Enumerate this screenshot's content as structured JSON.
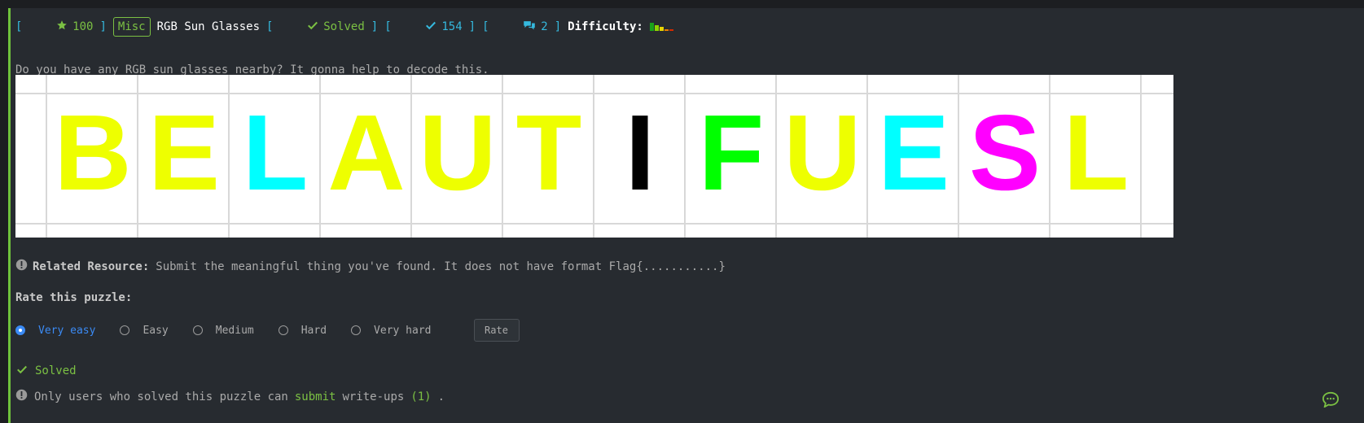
{
  "header": {
    "bracket_open": "[",
    "points": "100",
    "bracket_close": "]",
    "category": "Misc",
    "title": "RGB Sun Glasses",
    "solved_open": "[",
    "solved_label": "Solved",
    "solved_close": "]",
    "solves_open": "[",
    "solves_count": "154",
    "solves_close": "]",
    "comments_open": "[",
    "comments_count": "2",
    "comments_close": "]",
    "difficulty_label": "Difficulty:",
    "difficulty_colors": [
      "#1aa21a",
      "#8fd400",
      "#e6d300",
      "#e67e00",
      "#d42a00"
    ]
  },
  "description": "Do you have any RGB sun glasses nearby? It gonna help to decode this.",
  "puzzle_image": {
    "letters": [
      {
        "char": "B",
        "color": "#eeff00"
      },
      {
        "char": "E",
        "color": "#eeff00"
      },
      {
        "char": "L",
        "color": "#00ffff"
      },
      {
        "char": "A",
        "color": "#eeff00"
      },
      {
        "char": "U",
        "color": "#eeff00"
      },
      {
        "char": "T",
        "color": "#eeff00"
      },
      {
        "char": "I",
        "color": "#000000"
      },
      {
        "char": "F",
        "color": "#00ff00"
      },
      {
        "char": "U",
        "color": "#eeff00"
      },
      {
        "char": "E",
        "color": "#00ffff"
      },
      {
        "char": "S",
        "color": "#ff00ff"
      },
      {
        "char": "L",
        "color": "#eeff00"
      }
    ]
  },
  "resource": {
    "label": "Related Resource:",
    "text": "Submit the meaningful thing you've found. It does not have format Flag{...........}"
  },
  "rating": {
    "heading": "Rate this puzzle:",
    "options": [
      "Very easy",
      "Easy",
      "Medium",
      "Hard",
      "Very hard"
    ],
    "selected": "Very easy",
    "button": "Rate"
  },
  "status": {
    "solved": "Solved",
    "writeups_prefix": "Only users who solved this puzzle can",
    "writeups_link": "submit",
    "writeups_mid": "write-ups",
    "writeups_count": "(1)",
    "writeups_end": "."
  },
  "colors": {
    "accent_green": "#7bc043",
    "accent_cyan": "#35b9de",
    "selected_blue": "#3b8bf5"
  },
  "icons": [
    "star-icon",
    "check-icon",
    "comments-icon",
    "info-icon",
    "chat-icon"
  ]
}
